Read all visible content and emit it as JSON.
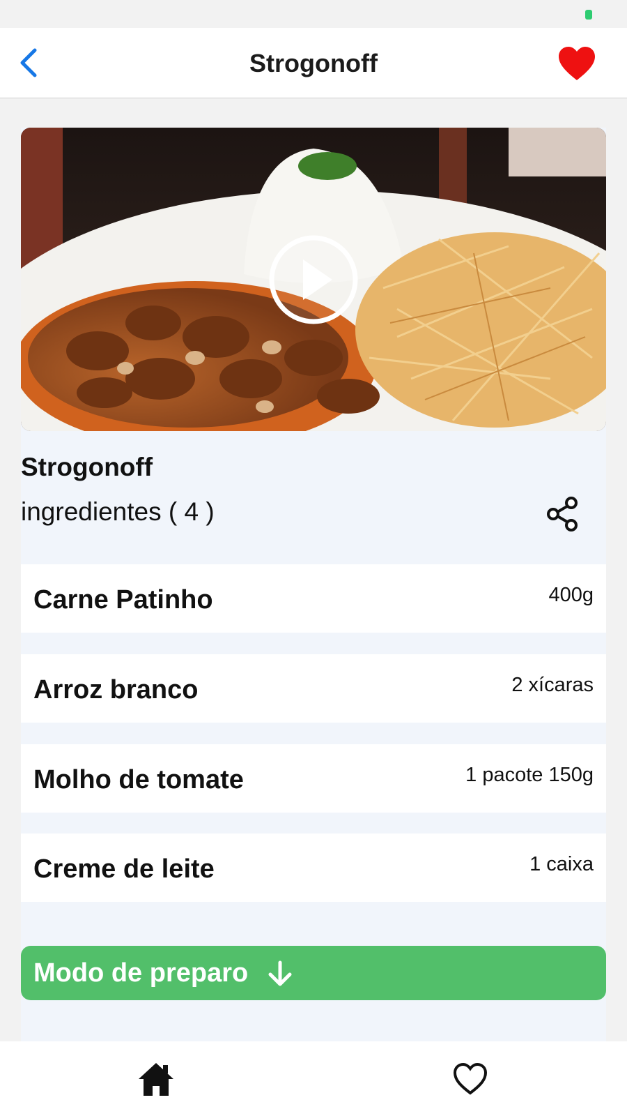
{
  "header": {
    "title": "Strogonoff",
    "back_icon": "chevron-left-icon",
    "favorite_icon": "heart-filled-icon",
    "accent_color": "#1677e6",
    "favorite_color": "#ee1111"
  },
  "recipe": {
    "title": "Strogonoff",
    "ingredients_label": "ingredientes ( 4  )",
    "share_icon": "share-icon",
    "play_icon": "play-circle-icon"
  },
  "ingredients": [
    {
      "name": "Carne Patinho",
      "quantity": "400g"
    },
    {
      "name": "Arroz branco",
      "quantity": "2 xícaras"
    },
    {
      "name": "Molho de tomate",
      "quantity": "1 pacote 150g"
    },
    {
      "name": "Creme de leite",
      "quantity": "1 caixa"
    }
  ],
  "preparation": {
    "label": "Modo de preparo",
    "arrow_icon": "arrow-down-icon",
    "color": "#52bf6a"
  },
  "tabbar": {
    "home_icon": "home-icon",
    "favorites_icon": "heart-outline-icon"
  }
}
